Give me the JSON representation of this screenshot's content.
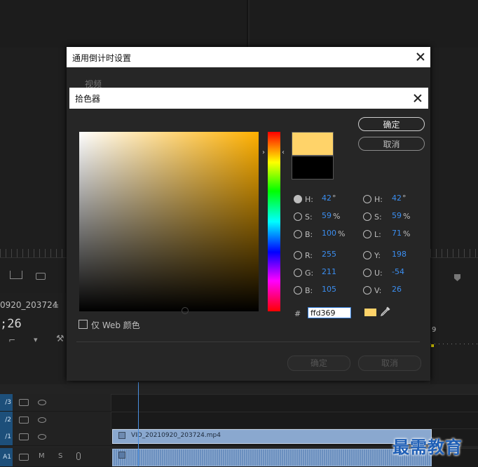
{
  "outer_dialog": {
    "title": "通用倒计时设置",
    "video_label": "视频",
    "ok_label": "确定",
    "cancel_label": "取消"
  },
  "picker": {
    "title": "拾色器",
    "ok_label": "确定",
    "cancel_label": "取消",
    "web_only_label": "仅 Web 颜色",
    "new_color": "#ffd369",
    "old_color": "#000000",
    "hsb": {
      "h_label": "H:",
      "h": "42",
      "h_unit": "°",
      "s_label": "S:",
      "s": "59",
      "s_unit": "%",
      "b_label": "B:",
      "b": "100",
      "b_unit": "%"
    },
    "rgb": {
      "r_label": "R:",
      "r": "255",
      "g_label": "G:",
      "g": "211",
      "b_label": "B:",
      "b": "105"
    },
    "hsl": {
      "h_label": "H:",
      "h": "42",
      "h_unit": "°",
      "s_label": "S:",
      "s": "59",
      "s_unit": "%",
      "l_label": "L:",
      "l": "71",
      "l_unit": "%"
    },
    "yuv": {
      "y_label": "Y:",
      "y": "198",
      "u_label": "U:",
      "u": "-54",
      "v_label": "V:",
      "v": "26"
    },
    "hex_prefix": "#",
    "hex_value": "ffd369"
  },
  "background": {
    "sequence_name": "0920_203724",
    "timecode": ";26",
    "ruler_number": "9",
    "tracks": [
      {
        "tag": "/3"
      },
      {
        "tag": "/2"
      },
      {
        "tag": "/1"
      },
      {
        "tag": "A1",
        "m": "M",
        "s": "S"
      }
    ],
    "clip_name": "VID_20210920_203724.mp4",
    "watermark": "最需教育"
  },
  "colors": {
    "accent_blue": "#3b8ef0",
    "picked": "#ffd369",
    "track_blue": "#1d4f7a"
  }
}
